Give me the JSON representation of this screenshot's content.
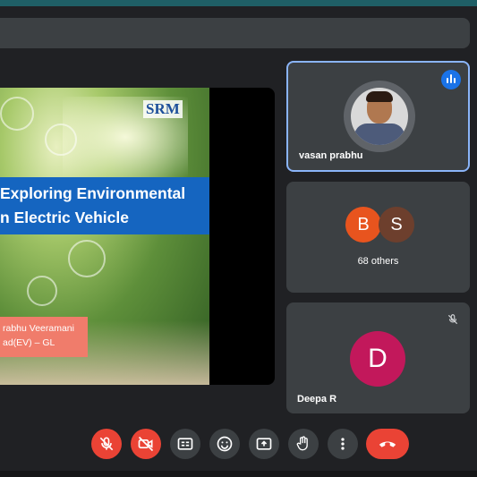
{
  "slide": {
    "logo": "SRM",
    "title_line1": "Exploring Environmental",
    "title_line2": "n Electric Vehicle",
    "presenter_line1": "rabhu Veeramani",
    "presenter_line2": "ad(EV) – GL"
  },
  "participants": [
    {
      "name": "vasan prabhu",
      "speaking": true
    },
    {
      "initial_1": "B",
      "initial_2": "S",
      "label": "68 others"
    },
    {
      "name": "Deepa R",
      "initial": "D",
      "muted": true
    }
  ],
  "colors": {
    "accent": "#8ab4f8",
    "speak_blue": "#1a73e8",
    "end_red": "#ea4335",
    "avatar_b": "#e8541e",
    "avatar_s": "#6d3f2d",
    "avatar_d": "#c2185b"
  },
  "controls": [
    {
      "icon": "mic-off-icon"
    },
    {
      "icon": "camera-off-icon"
    },
    {
      "icon": "captions-icon"
    },
    {
      "icon": "emoji-icon"
    },
    {
      "icon": "present-icon"
    },
    {
      "icon": "raise-hand-icon"
    },
    {
      "icon": "more-options-icon"
    },
    {
      "icon": "end-call-icon"
    }
  ]
}
